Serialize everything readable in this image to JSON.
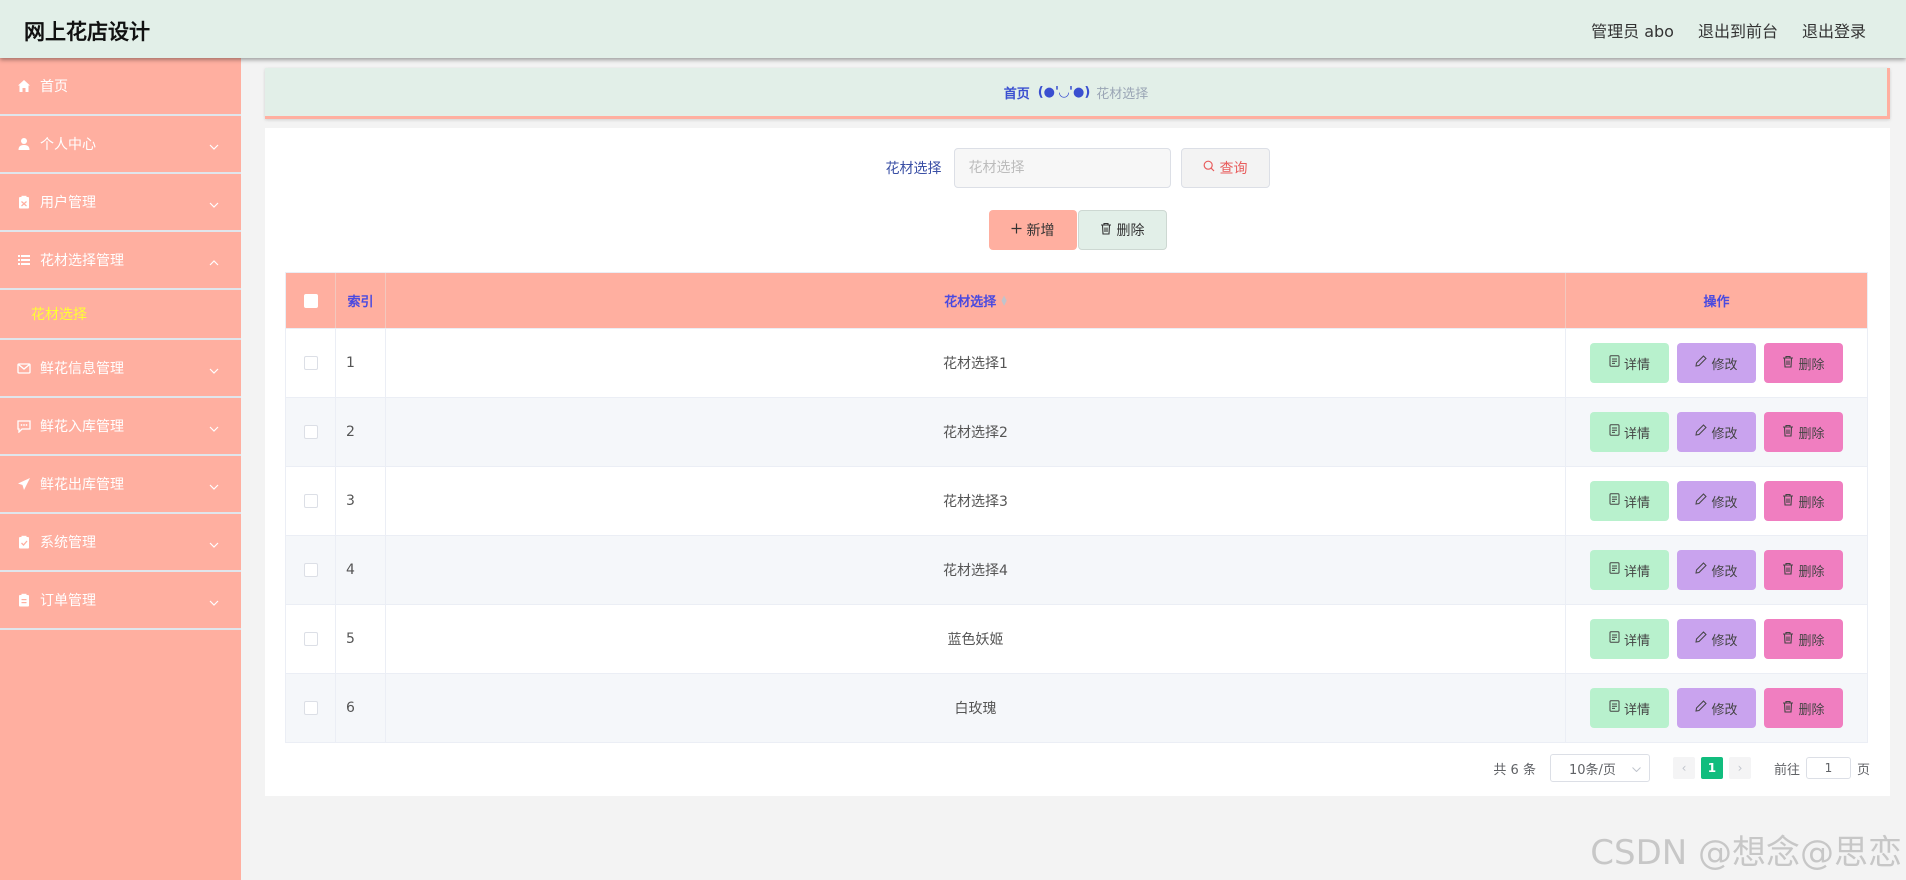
{
  "header": {
    "title": "网上花店设计",
    "user": "管理员 abo",
    "to_front": "退出到前台",
    "logout": "退出登录"
  },
  "sidebar": {
    "items": [
      {
        "label": "首页",
        "icon": "home-icon"
      },
      {
        "label": "个人中心",
        "icon": "user-icon"
      },
      {
        "label": "用户管理",
        "icon": "clipboard-icon"
      },
      {
        "label": "花材选择管理",
        "icon": "list-icon"
      },
      {
        "label": "鲜花信息管理",
        "icon": "mail-icon"
      },
      {
        "label": "鲜花入库管理",
        "icon": "chat-icon"
      },
      {
        "label": "鲜花出库管理",
        "icon": "send-icon"
      },
      {
        "label": "系统管理",
        "icon": "clipboard-check-icon"
      },
      {
        "label": "订单管理",
        "icon": "clipboard-icon"
      }
    ],
    "sub_item": "花材选择"
  },
  "breadcrumb": {
    "home": "首页",
    "separator": "(●'◡'●)",
    "current": "花材选择"
  },
  "search": {
    "label": "花材选择",
    "placeholder": "花材选择",
    "button": "查询"
  },
  "actions": {
    "add": "新增",
    "delete": "删除"
  },
  "table": {
    "headers": {
      "index": "索引",
      "name": "花材选择",
      "ops": "操作"
    },
    "rows": [
      {
        "index": "1",
        "name": "花材选择1"
      },
      {
        "index": "2",
        "name": "花材选择2"
      },
      {
        "index": "3",
        "name": "花材选择3"
      },
      {
        "index": "4",
        "name": "花材选择4"
      },
      {
        "index": "5",
        "name": "蓝色妖姬"
      },
      {
        "index": "6",
        "name": "白玫瑰"
      }
    ],
    "op_labels": {
      "detail": "详情",
      "edit": "修改",
      "delete": "删除"
    }
  },
  "pagination": {
    "total": "共 6 条",
    "page_size": "10条/页",
    "current_page": "1",
    "goto_prefix": "前往",
    "goto_value": "1",
    "goto_suffix": "页"
  },
  "watermark": "CSDN @想念@思恋",
  "colors": {
    "sidebar_bg": "#ffafa0",
    "header_bg": "#e2efe8",
    "accent_active_page": "#11bd7e",
    "detail_btn": "#b8f1cd",
    "edit_btn": "#c9a3ee",
    "delete_btn": "#f07ec0"
  }
}
